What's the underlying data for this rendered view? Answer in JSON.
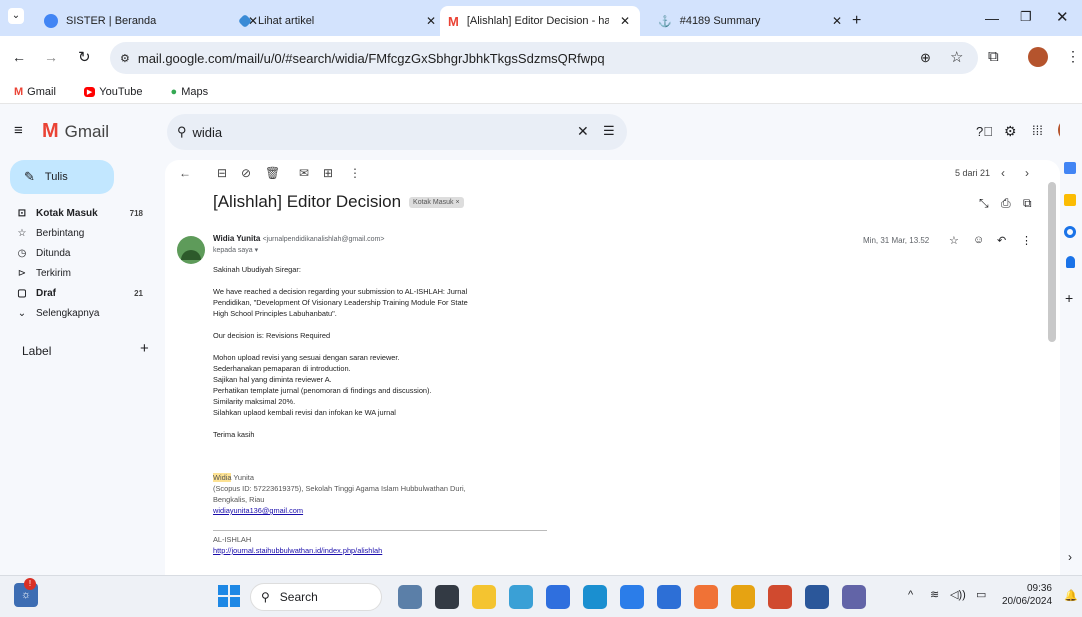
{
  "browser": {
    "tabs": [
      {
        "title": "SISTER | Beranda",
        "color": "#4285f4"
      },
      {
        "title": "Lihat artikel",
        "color": "#3a8bd6"
      },
      {
        "title": "[Alishlah] Editor Decision - hafiz",
        "color": "#ea4335"
      },
      {
        "title": "#4189 Summary",
        "color": "#9c9c9c"
      }
    ],
    "url": "mail.google.com/mail/u/0/#search/widia/FMfcgzGxSbhgrJbhkTkgsSdzmsQRfwpq",
    "bookmarks": [
      "Gmail",
      "YouTube",
      "Maps"
    ]
  },
  "gmail": {
    "logo": "Gmail",
    "search_value": "widia",
    "compose": "Tulis",
    "nav": [
      {
        "label": "Kotak Masuk",
        "count": "718",
        "icon": "inbox-icon",
        "bold": true
      },
      {
        "label": "Berbintang",
        "count": "",
        "icon": "star-icon",
        "bold": false
      },
      {
        "label": "Ditunda",
        "count": "",
        "icon": "clock-icon",
        "bold": false
      },
      {
        "label": "Terkirim",
        "count": "",
        "icon": "send-icon",
        "bold": false
      },
      {
        "label": "Draf",
        "count": "21",
        "icon": "draft-icon",
        "bold": true
      },
      {
        "label": "Selengkapnya",
        "count": "",
        "icon": "chevron-down-icon",
        "bold": false
      }
    ],
    "labels_heading": "Label",
    "pager": "5 dari 21"
  },
  "email": {
    "subject": "[Alishlah] Editor Decision",
    "tag": "Kotak Masuk ×",
    "sender_name": "Widia Yunita",
    "sender_email": "<jurnalpendidikanalishlah@gmail.com>",
    "to": "kepada saya ▾",
    "date": "Min, 31 Mar, 13.52",
    "body_lines": [
      "Sakinah Ubudiyah Siregar:",
      "",
      "We have reached a decision regarding your submission to AL-ISHLAH: Jurnal",
      "Pendidikan, \"Development Of Visionary Leadership Training Module For State",
      "High School  Principles Labuhanbatu\".",
      "",
      "Our decision is: Revisions Required",
      "",
      "Mohon upload revisi yang sesuai dengan saran reviewer.",
      "Sederhanakan pemaparan di introduction.",
      "Sajikan hal yang diminta reviewer A.",
      "Perhatikan template jurnal (penomoran di findings and discussion).",
      "Similarity maksimal 20%.",
      "Silahkan uplaod kembali revisi dan infokan ke WA jurnal",
      "",
      "Terima kasih"
    ],
    "sig_first": "Widia",
    "sig_last": " Yunita",
    "sig_line1": "(Scopus ID: 57223619375), Sekolah Tinggi Agama Islam Hubbulwathan Duri,",
    "sig_line2": "Bengkalis, Riau",
    "sig_email": "widiayunita136@gmail.com",
    "footer_org": "AL-ISHLAH",
    "footer_link": "http://journal.staihubbulwathan.id/index.php/alishlah"
  },
  "taskbar": {
    "search": "Search",
    "time": "09:36",
    "date": "20/06/2024",
    "pinned": [
      {
        "name": "landscape-app-icon",
        "color": "#5b7fa8"
      },
      {
        "name": "app-dark-icon",
        "color": "#333a44"
      },
      {
        "name": "file-explorer-icon",
        "color": "#f4c430"
      },
      {
        "name": "app-blue-icon",
        "color": "#3aa0d6"
      },
      {
        "name": "myk-app-icon",
        "color": "#2f6fde"
      },
      {
        "name": "edge-icon",
        "color": "#1a8fd0"
      },
      {
        "name": "chrome-canary-icon",
        "color": "#2b7de9"
      },
      {
        "name": "store-icon",
        "color": "#2d6fd6"
      },
      {
        "name": "app-orange-icon",
        "color": "#f07236"
      },
      {
        "name": "chrome-icon",
        "color": "#e6a312"
      },
      {
        "name": "chrome-dev-icon",
        "color": "#d04a2f"
      },
      {
        "name": "word-icon",
        "color": "#2b579a"
      },
      {
        "name": "teams-icon",
        "color": "#6264a7"
      }
    ]
  }
}
